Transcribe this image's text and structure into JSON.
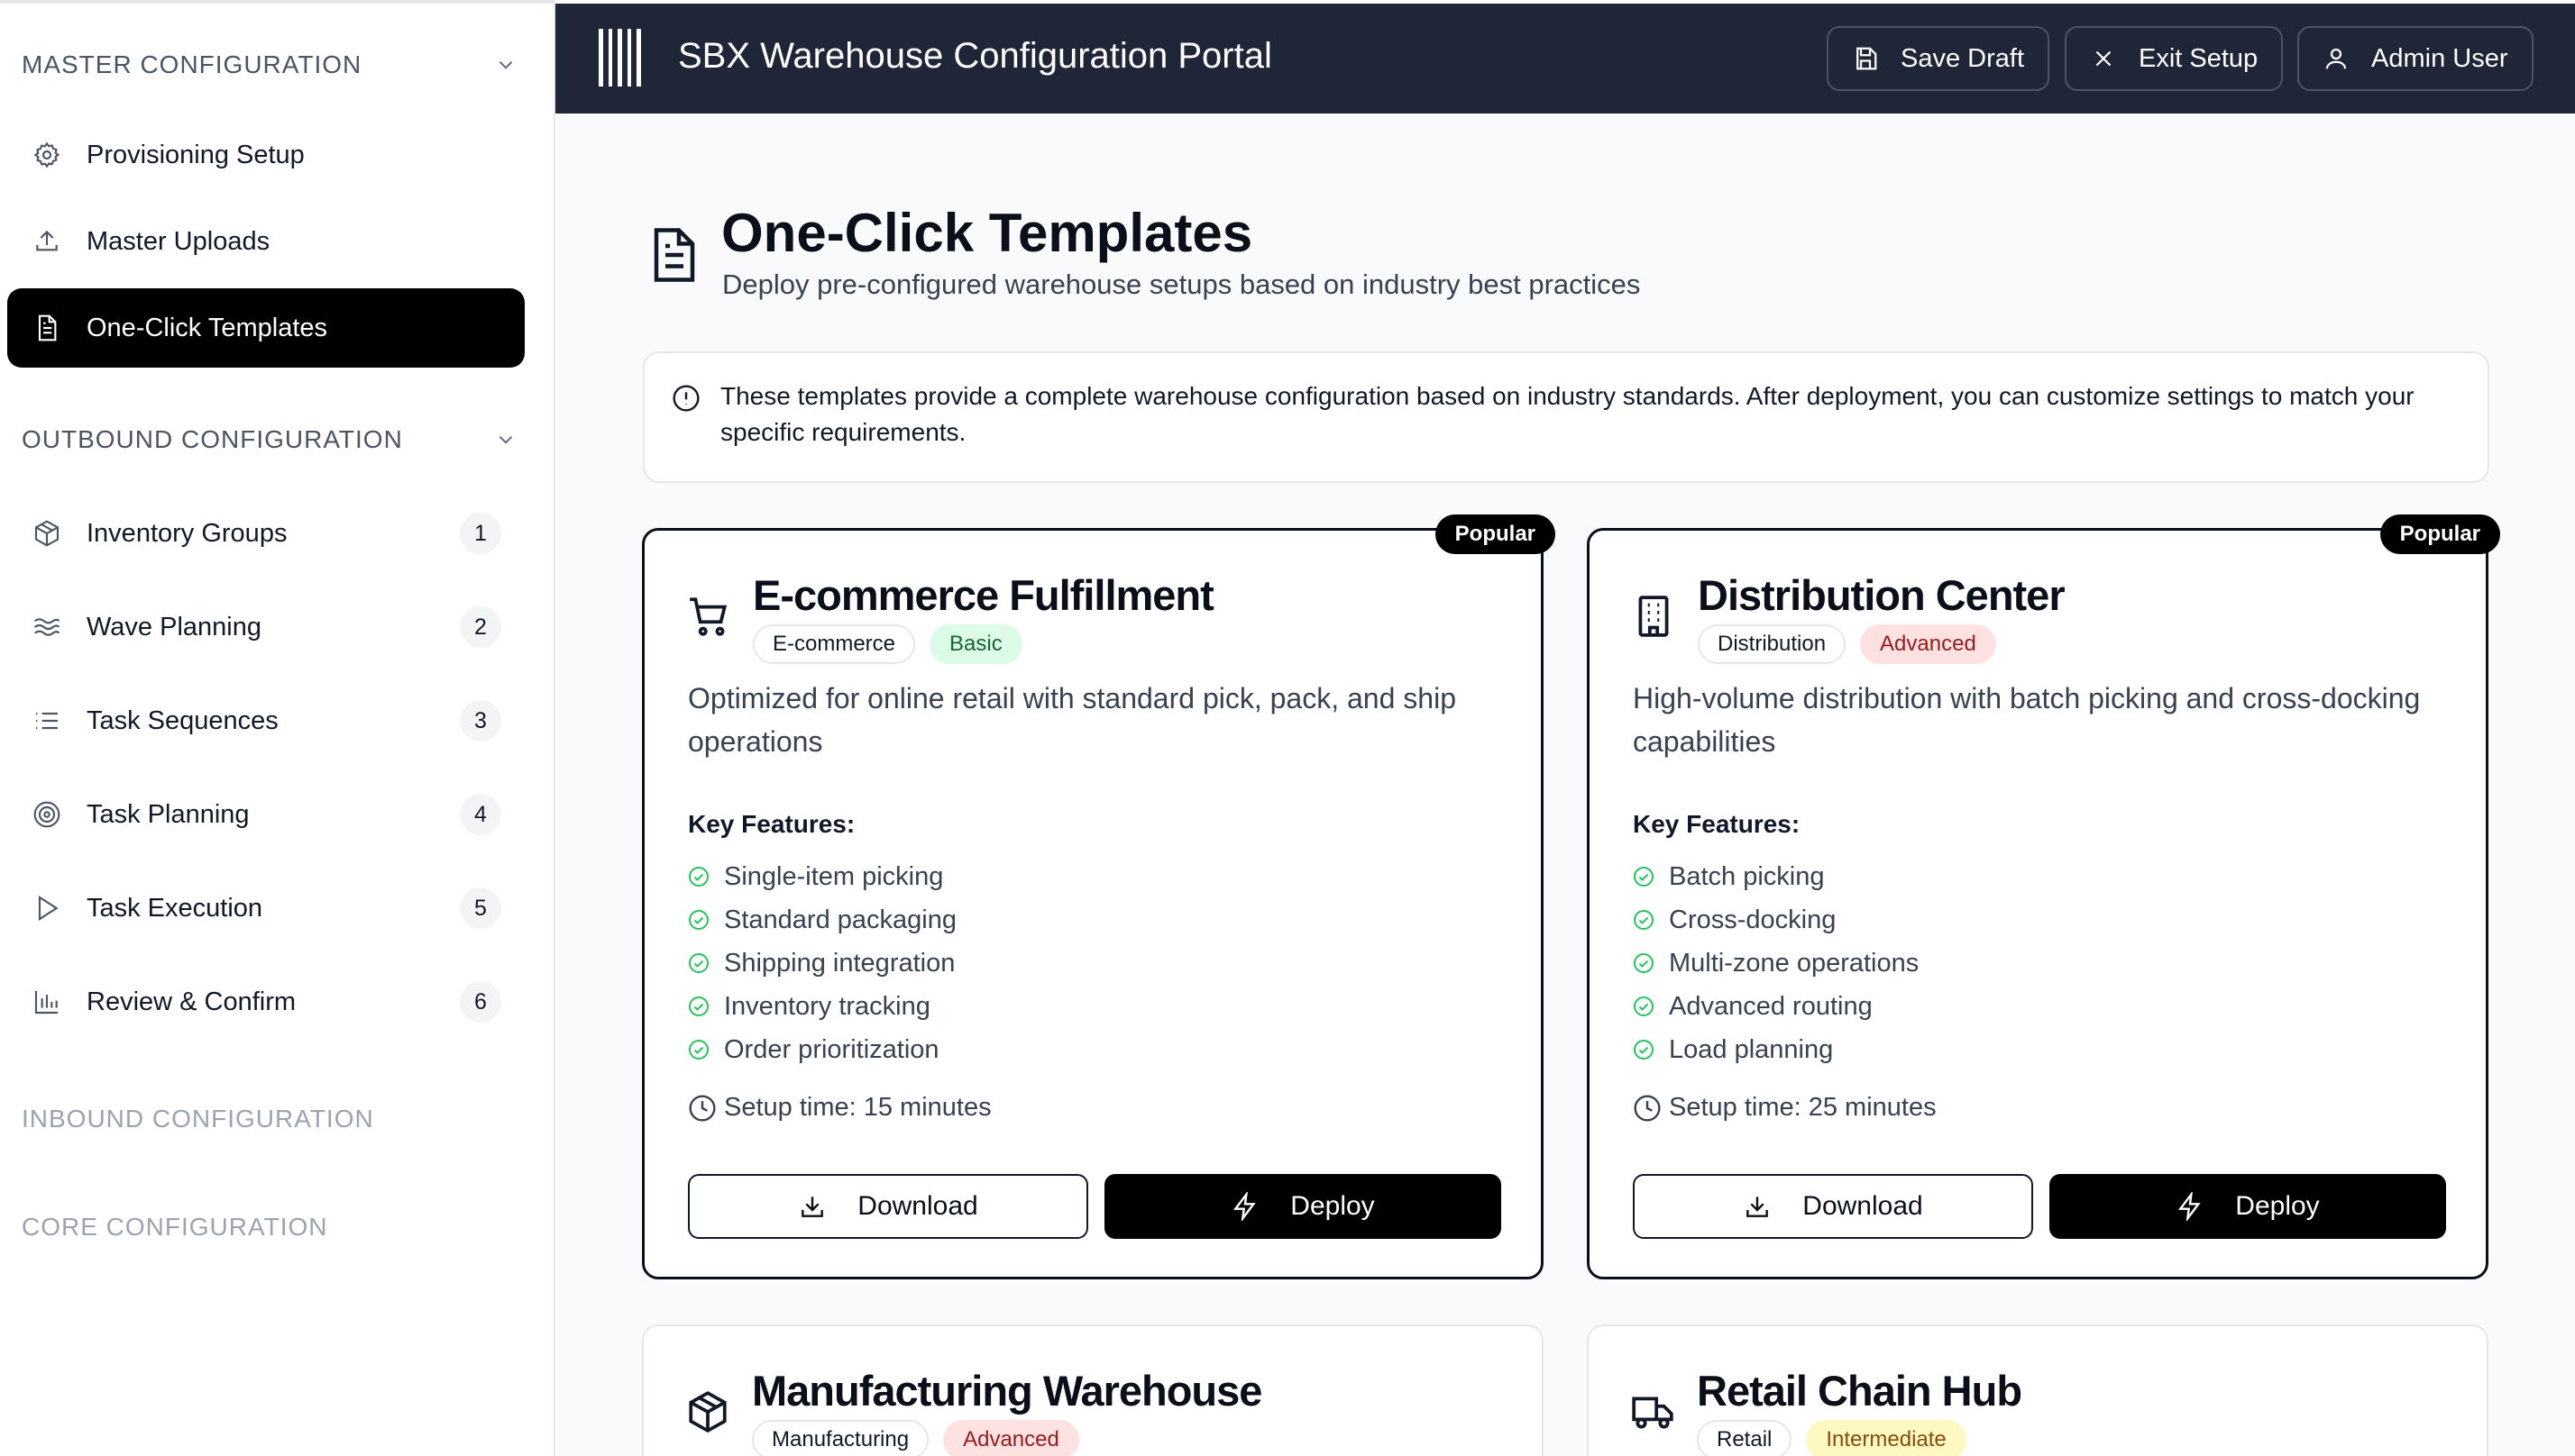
{
  "sidebar": {
    "master_header": "MASTER CONFIGURATION",
    "master_items": [
      {
        "label": "Provisioning Setup",
        "icon": "gear-icon"
      },
      {
        "label": "Master Uploads",
        "icon": "upload-icon"
      },
      {
        "label": "One-Click Templates",
        "icon": "document-icon",
        "active": true
      }
    ],
    "outbound_header": "OUTBOUND CONFIGURATION",
    "outbound_items": [
      {
        "label": "Inventory Groups",
        "icon": "package-icon",
        "badge": "1"
      },
      {
        "label": "Wave Planning",
        "icon": "waves-icon",
        "badge": "2"
      },
      {
        "label": "Task Sequences",
        "icon": "list-icon",
        "badge": "3"
      },
      {
        "label": "Task Planning",
        "icon": "target-icon",
        "badge": "4"
      },
      {
        "label": "Task Execution",
        "icon": "play-icon",
        "badge": "5"
      },
      {
        "label": "Review & Confirm",
        "icon": "bar-chart-icon",
        "badge": "6"
      }
    ],
    "inbound_header": "INBOUND CONFIGURATION",
    "core_header": "CORE CONFIGURATION"
  },
  "topbar": {
    "title": "SBX Warehouse Configuration Portal",
    "save_label": "Save Draft",
    "exit_label": "Exit Setup",
    "user_label": "Admin User"
  },
  "main": {
    "title": "One-Click Templates",
    "subtitle": "Deploy pre-configured warehouse setups based on industry best practices",
    "info": "These templates provide a complete warehouse configuration based on industry standards. After deployment, you can customize settings to match your specific requirements.",
    "key_features_label": "Key Features:",
    "download_label": "Download",
    "deploy_label": "Deploy",
    "popular_label": "Popular",
    "templates": [
      {
        "title": "E-commerce Fulfillment",
        "icon": "cart-icon",
        "tags": [
          "E-commerce",
          "Basic"
        ],
        "description": "Optimized for online retail with standard pick, pack, and ship operations",
        "features": [
          "Single-item picking",
          "Standard packaging",
          "Shipping integration",
          "Inventory tracking",
          "Order prioritization"
        ],
        "setup_time": "Setup time: 15 minutes"
      },
      {
        "title": "Distribution Center",
        "icon": "building-icon",
        "tags": [
          "Distribution",
          "Advanced"
        ],
        "description": "High-volume distribution with batch picking and cross-docking capabilities",
        "features": [
          "Batch picking",
          "Cross-docking",
          "Multi-zone operations",
          "Advanced routing",
          "Load planning"
        ],
        "setup_time": "Setup time: 25 minutes"
      },
      {
        "title": "Manufacturing Warehouse",
        "icon": "package-icon",
        "tags": [
          "Manufacturing",
          "Advanced"
        ]
      },
      {
        "title": "Retail Chain Hub",
        "icon": "truck-icon",
        "tags": [
          "Retail",
          "Intermediate"
        ]
      }
    ]
  }
}
